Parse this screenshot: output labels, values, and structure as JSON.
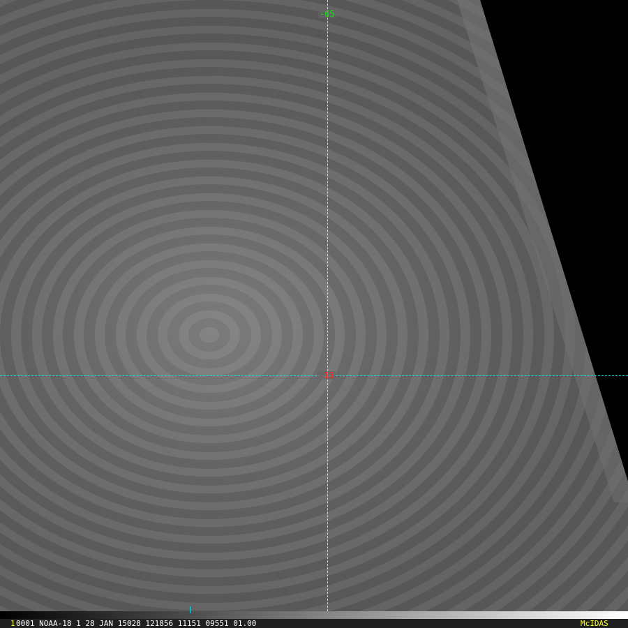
{
  "overlay": {
    "top_label": "-65",
    "center_label": "-15",
    "colors": {
      "top_label": "#19e019",
      "center_label": "#ff2020",
      "hline": "#1fd8e0"
    }
  },
  "infobar": {
    "frame_number": "1",
    "text": "0001 NOAA-18     1 28 JAN 15028 121856 11151 09551 01.00",
    "brand": "McIDAS"
  }
}
